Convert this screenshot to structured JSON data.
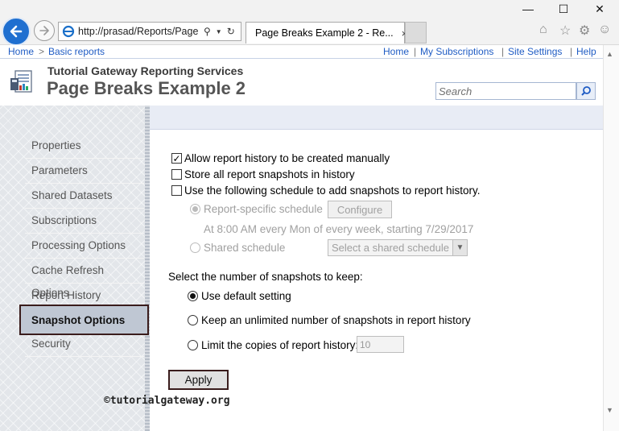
{
  "browser": {
    "address": "http://prasad/Reports/Page:",
    "tab_title": "Page Breaks Example 2 - Re...",
    "tab_close": "×",
    "window_controls": {
      "minimize": "—",
      "maximize": "☐",
      "close": "✕"
    }
  },
  "top_links": {
    "breadcrumb_home": "Home",
    "breadcrumb_sep": ">",
    "breadcrumb_folder": "Basic reports",
    "home": "Home",
    "my_subscriptions": "My Subscriptions",
    "site_settings": "Site Settings",
    "help": "Help",
    "sep": "|"
  },
  "header": {
    "site_name": "Tutorial Gateway Reporting Services",
    "page_title": "Page Breaks Example 2",
    "search_placeholder": "Search"
  },
  "sidebar": {
    "items": [
      {
        "label": "Properties"
      },
      {
        "label": "Parameters"
      },
      {
        "label": "Shared Datasets"
      },
      {
        "label": "Subscriptions"
      },
      {
        "label": "Processing Options"
      },
      {
        "label": "Cache Refresh Options"
      },
      {
        "label": "Report History"
      },
      {
        "label": "Snapshot Options",
        "selected": true
      },
      {
        "label": "Security"
      }
    ]
  },
  "options": {
    "allow_manual": {
      "label": "Allow report history to be created manually",
      "checked": true
    },
    "store_all": {
      "label": "Store all report snapshots in history",
      "checked": false
    },
    "use_schedule": {
      "label": "Use the following schedule to add snapshots to report history.",
      "checked": false
    },
    "report_specific": {
      "label": "Report-specific schedule",
      "selected": true,
      "disabled": true
    },
    "configure_label": "Configure",
    "schedule_description": "At 8:00 AM every Mon of every week, starting 7/29/2017",
    "shared_schedule": {
      "label": "Shared schedule",
      "selected": false,
      "disabled": true
    },
    "shared_select_value": "Select a shared schedule",
    "snapshots_heading": "Select the number of snapshots to keep:",
    "use_default": {
      "label": "Use default setting",
      "selected": true
    },
    "unlimited": {
      "label": "Keep an unlimited number of snapshots in report history",
      "selected": false
    },
    "limit": {
      "label": "Limit the copies of report history:",
      "selected": false
    },
    "limit_value": "10",
    "apply_label": "Apply"
  },
  "watermark": "©tutorialgateway.org"
}
